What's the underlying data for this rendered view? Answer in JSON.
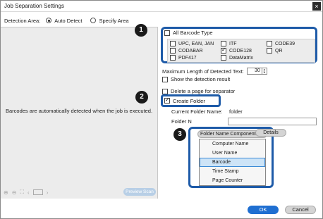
{
  "window": {
    "title": "Job Separation Settings",
    "close": "×"
  },
  "detection_area": {
    "label": "Detection Area:",
    "options": [
      "Auto Detect",
      "Specify Area"
    ],
    "selected": "Auto Detect"
  },
  "preview": {
    "message": "Barcodes are automatically detected when the job is executed.",
    "scan_button": "Preview Scan",
    "tool_icons": [
      "zoom-in-icon",
      "zoom-out-icon",
      "fit-icon",
      "prev-page-icon"
    ]
  },
  "barcode": {
    "all_label": "All Barcode Type",
    "all_checked": false,
    "types": [
      {
        "label": "UPC, EAN, JAN",
        "checked": false
      },
      {
        "label": "ITF",
        "checked": false
      },
      {
        "label": "CODE39",
        "checked": false
      },
      {
        "label": "CODABAR",
        "checked": false
      },
      {
        "label": "CODE128",
        "checked": true
      },
      {
        "label": "QR",
        "checked": false
      },
      {
        "label": "PDF417",
        "checked": false
      },
      {
        "label": "DataMatrix",
        "checked": false
      }
    ]
  },
  "max_length": {
    "label": "Maximum Length of Detected Text:",
    "value": "30"
  },
  "show_result": {
    "label": "Show the detection result",
    "checked": false
  },
  "delete_page": {
    "label": "Delete a page for separator",
    "checked": false
  },
  "create_folder": {
    "label": "Create Folder",
    "checked": true
  },
  "current_folder": {
    "label": "Current Folder Name:",
    "value": "folder"
  },
  "folder_name": {
    "label": "Folder N",
    "value": ""
  },
  "components": {
    "button": "Folder Name Components ▼",
    "options": [
      "Computer Name",
      "User Name",
      "Barcode",
      "Time Stamp",
      "Page Counter"
    ],
    "highlighted": "Barcode"
  },
  "details_button": "Details",
  "badges": [
    "1",
    "2",
    "3"
  ],
  "footer": {
    "ok": "OK",
    "cancel": "Cancel"
  },
  "colors": {
    "highlight_frame": "#1e5ba8",
    "ok_button": "#1f6fd1",
    "badge": "#1a1a1a"
  }
}
